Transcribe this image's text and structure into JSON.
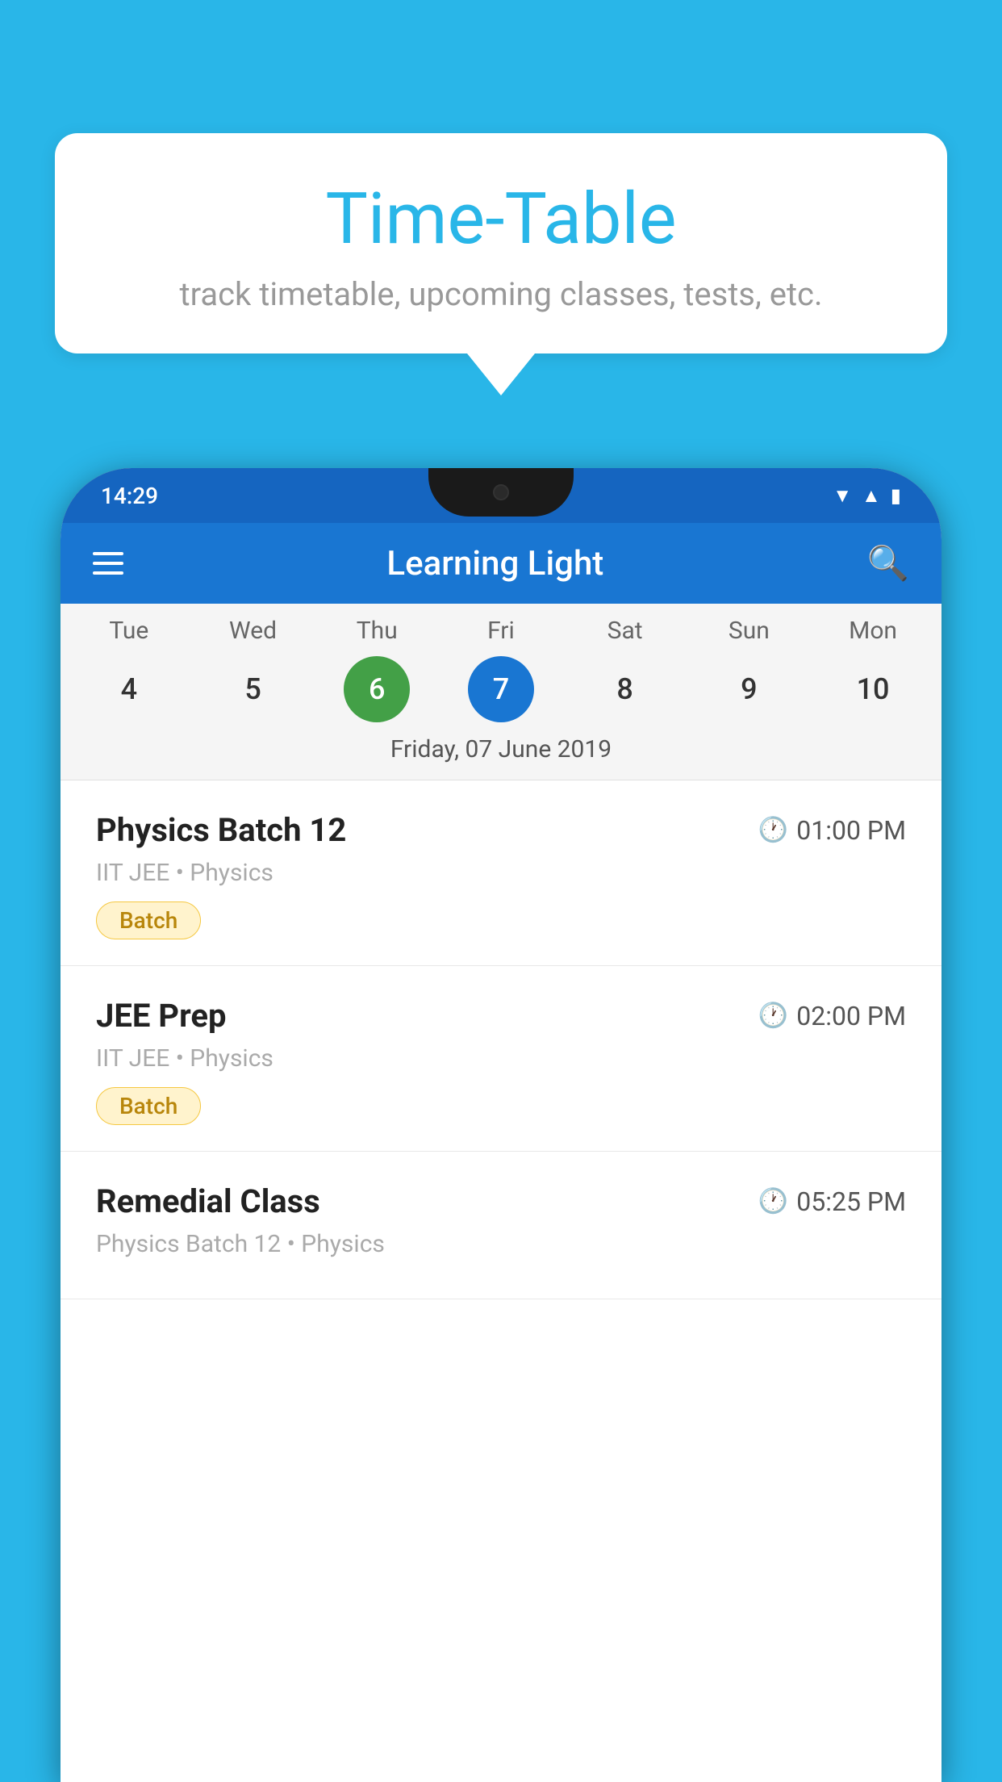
{
  "background": {
    "color": "#29b6e8"
  },
  "speech_bubble": {
    "title": "Time-Table",
    "subtitle": "track timetable, upcoming classes, tests, etc."
  },
  "phone": {
    "status_bar": {
      "time": "14:29"
    },
    "app_bar": {
      "title": "Learning Light",
      "menu_icon": "hamburger-icon",
      "search_icon": "search-icon"
    },
    "calendar": {
      "days": [
        {
          "name": "Tue",
          "number": "4",
          "state": "normal"
        },
        {
          "name": "Wed",
          "number": "5",
          "state": "normal"
        },
        {
          "name": "Thu",
          "number": "6",
          "state": "today"
        },
        {
          "name": "Fri",
          "number": "7",
          "state": "selected"
        },
        {
          "name": "Sat",
          "number": "8",
          "state": "normal"
        },
        {
          "name": "Sun",
          "number": "9",
          "state": "normal"
        },
        {
          "name": "Mon",
          "number": "10",
          "state": "normal"
        }
      ],
      "selected_date_label": "Friday, 07 June 2019"
    },
    "schedule": [
      {
        "title": "Physics Batch 12",
        "time": "01:00 PM",
        "subtitle": "IIT JEE • Physics",
        "badge": "Batch"
      },
      {
        "title": "JEE Prep",
        "time": "02:00 PM",
        "subtitle": "IIT JEE • Physics",
        "badge": "Batch"
      },
      {
        "title": "Remedial Class",
        "time": "05:25 PM",
        "subtitle": "Physics Batch 12 • Physics",
        "badge": null
      }
    ]
  }
}
